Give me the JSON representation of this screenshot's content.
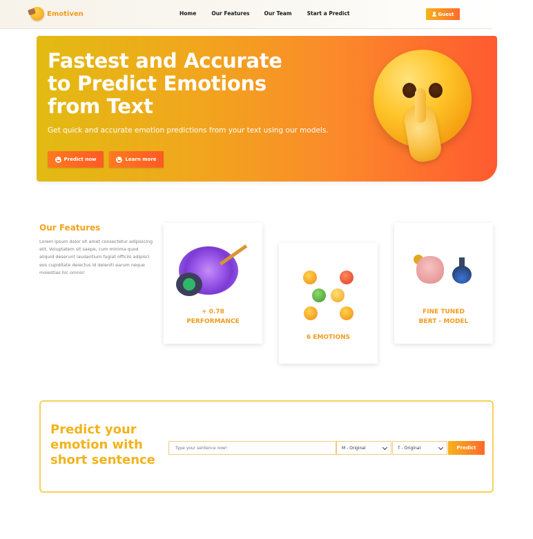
{
  "nav": {
    "brand": "Emotiven",
    "links": [
      "Home",
      "Our Features",
      "Our Team",
      "Start a Predict"
    ],
    "guest_label": "Guest"
  },
  "hero": {
    "title": "Fastest and Accurate to Predict Emotions from Text",
    "subtitle": "Get quick and accurate emotion predictions from your text using our models.",
    "predict_now_label": "Predict now",
    "learn_more_label": "Learn more"
  },
  "features": {
    "title": "Our Features",
    "text": "Lorem ipsum dolor sit amet consectetur adipisicing elit. Voluptatem sit saepe, cum minima quod aliquid deserunt laudantium fugiat officiis adipisci eos cupiditate delectus id deleniti earum neque molestias hic omnis!",
    "cards": [
      {
        "label_line1": "+ 0.78",
        "label_line2": "PERFORMANCE"
      },
      {
        "label_line1": "6 EMOTIONS",
        "label_line2": ""
      },
      {
        "label_line1": "FINE TUNED",
        "label_line2": "BERT - MODEL"
      }
    ]
  },
  "predict": {
    "title": "Predict your emotion with short sentence",
    "input_placeholder": "Type your sentence now!",
    "model_select": "M - Original",
    "text_select": "T - Original",
    "button_label": "Predict"
  },
  "colors": {
    "accent_yellow": "#f2b31b",
    "accent_orange": "#ff6a2a"
  }
}
